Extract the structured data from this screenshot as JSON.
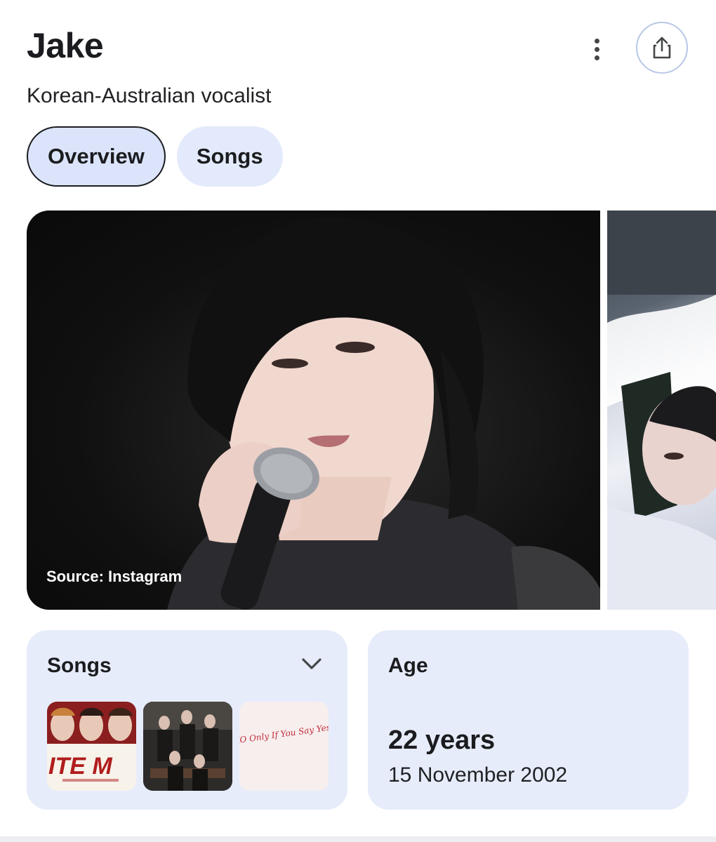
{
  "header": {
    "title": "Jake",
    "subtitle": "Korean-Australian vocalist",
    "more_icon": "more-vert-icon",
    "share_icon": "share-icon"
  },
  "tabs": [
    {
      "label": "Overview",
      "active": true
    },
    {
      "label": "Songs",
      "active": false
    }
  ],
  "images": {
    "main_source": "Source: Instagram"
  },
  "songs_card": {
    "title": "Songs",
    "expand_icon": "chevron-down-icon",
    "thumbnails": [
      {
        "text": "ITE M"
      },
      {
        "text": ""
      },
      {
        "text": "XO Only If You Say Yes"
      }
    ]
  },
  "age_card": {
    "title": "Age",
    "value": "22 years",
    "date": "15 November 2002"
  },
  "colors": {
    "card_bg": "#e6ecfa",
    "tab_bg": "#e3eafb",
    "text_dark": "#1b1c1f"
  }
}
